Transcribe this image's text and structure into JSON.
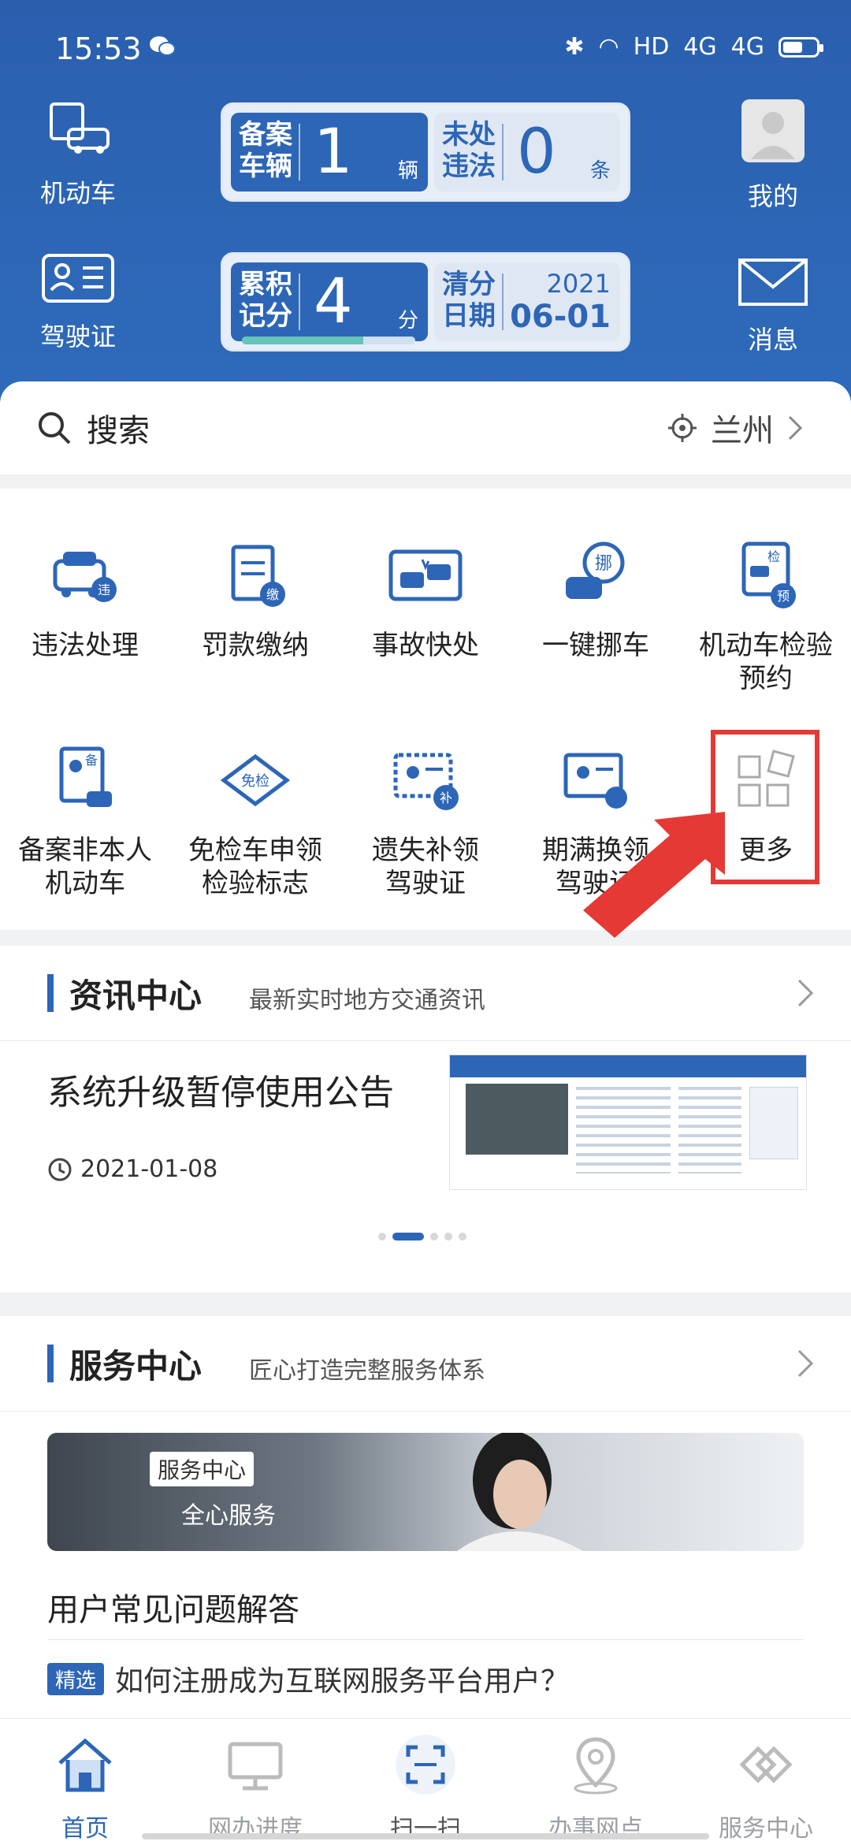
{
  "status_bar": {
    "time": "15:53",
    "network": "HD",
    "signal1": "4G",
    "signal2": "4G",
    "battery_level": 0.6
  },
  "header": {
    "vehicle_label": "机动车",
    "license_label": "驾驶证",
    "me_label": "我的",
    "message_label": "消息",
    "card1": {
      "left_title": "备案车辆",
      "left_value": "1",
      "left_unit": "辆",
      "right_title": "未处违法",
      "right_value": "0",
      "right_unit": "条"
    },
    "card2": {
      "left_title": "累积记分",
      "left_value": "4",
      "left_unit": "分",
      "right_title": "清分日期",
      "year": "2021",
      "date": "06-01",
      "progress": 0.7
    }
  },
  "search": {
    "placeholder": "搜索",
    "city": "兰州"
  },
  "services": [
    {
      "label": "违法处理",
      "icon": "violation-car-icon"
    },
    {
      "label": "罚款缴纳",
      "icon": "fine-payment-icon"
    },
    {
      "label": "事故快处",
      "icon": "accident-icon"
    },
    {
      "label": "一键挪车",
      "icon": "move-car-icon"
    },
    {
      "label": "机动车检验预约",
      "icon": "inspection-appointment-icon"
    },
    {
      "label": "备案非本人机动车",
      "icon": "filing-vehicle-icon"
    },
    {
      "label": "免检车申领检验标志",
      "icon": "exempt-inspection-icon"
    },
    {
      "label": "遗失补领驾驶证",
      "icon": "replace-license-icon"
    },
    {
      "label": "期满换领驾驶证",
      "icon": "renew-license-icon"
    },
    {
      "label": "更多",
      "icon": "more-grid-icon"
    }
  ],
  "news": {
    "title": "资讯中心",
    "subtitle": "最新实时地方交通资讯",
    "headline": "系统升级暂停使用公告",
    "date": "2021-01-08",
    "active_dot": 1,
    "dot_count": 5
  },
  "service_center": {
    "title": "服务中心",
    "subtitle": "匠心打造完整服务体系",
    "banner_tag": "服务中心",
    "banner_text": "全心服务",
    "faq_title": "用户常见问题解答",
    "faq_tag": "精选",
    "faq_item": "如何注册成为互联网服务平台用户？"
  },
  "tabbar": [
    {
      "label": "首页",
      "icon": "home-icon",
      "active": true
    },
    {
      "label": "网办进度",
      "icon": "monitor-icon",
      "active": false
    },
    {
      "label": "扫一扫",
      "icon": "scan-icon",
      "active": false
    },
    {
      "label": "办事网点",
      "icon": "location-pin-icon",
      "active": false
    },
    {
      "label": "服务中心",
      "icon": "handshake-icon",
      "active": false
    }
  ],
  "colors": {
    "primary": "#2d66b7",
    "header": "#2f6bbb",
    "highlight": "#e53935"
  }
}
